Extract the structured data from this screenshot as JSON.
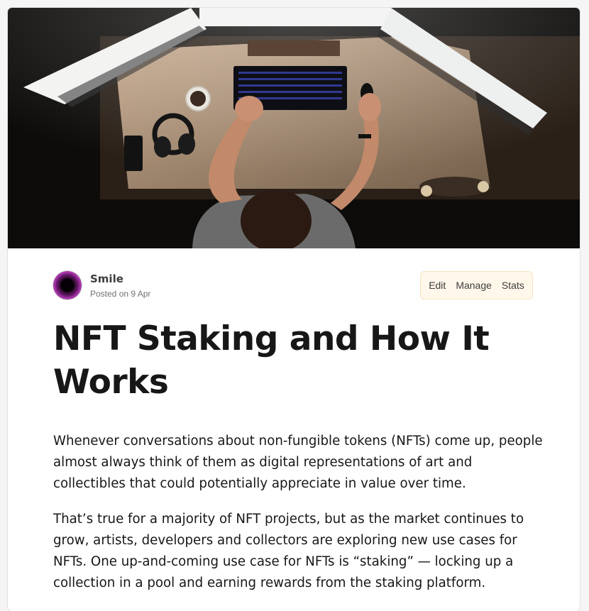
{
  "cover_image": {
    "alt": "",
    "description_icon": "cover-image"
  },
  "author": {
    "name": "Smile",
    "posted": "Posted on 9 Apr"
  },
  "actions": [
    {
      "label": "Edit"
    },
    {
      "label": "Manage"
    },
    {
      "label": "Stats"
    }
  ],
  "article": {
    "title": "NFT Staking and How It Works",
    "paragraphs": [
      "Whenever conversations about non-fungible tokens (NFTs) come up, people almost always think of them as digital representations of art and collectibles that could potentially appreciate in value over time.",
      "That’s true for a majority of NFT projects, but as the market continues to grow, artists, developers and collectors are exploring new use cases for NFTs. One up-and-coming use case for NFTs is “staking” — locking up a collection in a pool and earning rewards from the staking platform."
    ]
  }
}
